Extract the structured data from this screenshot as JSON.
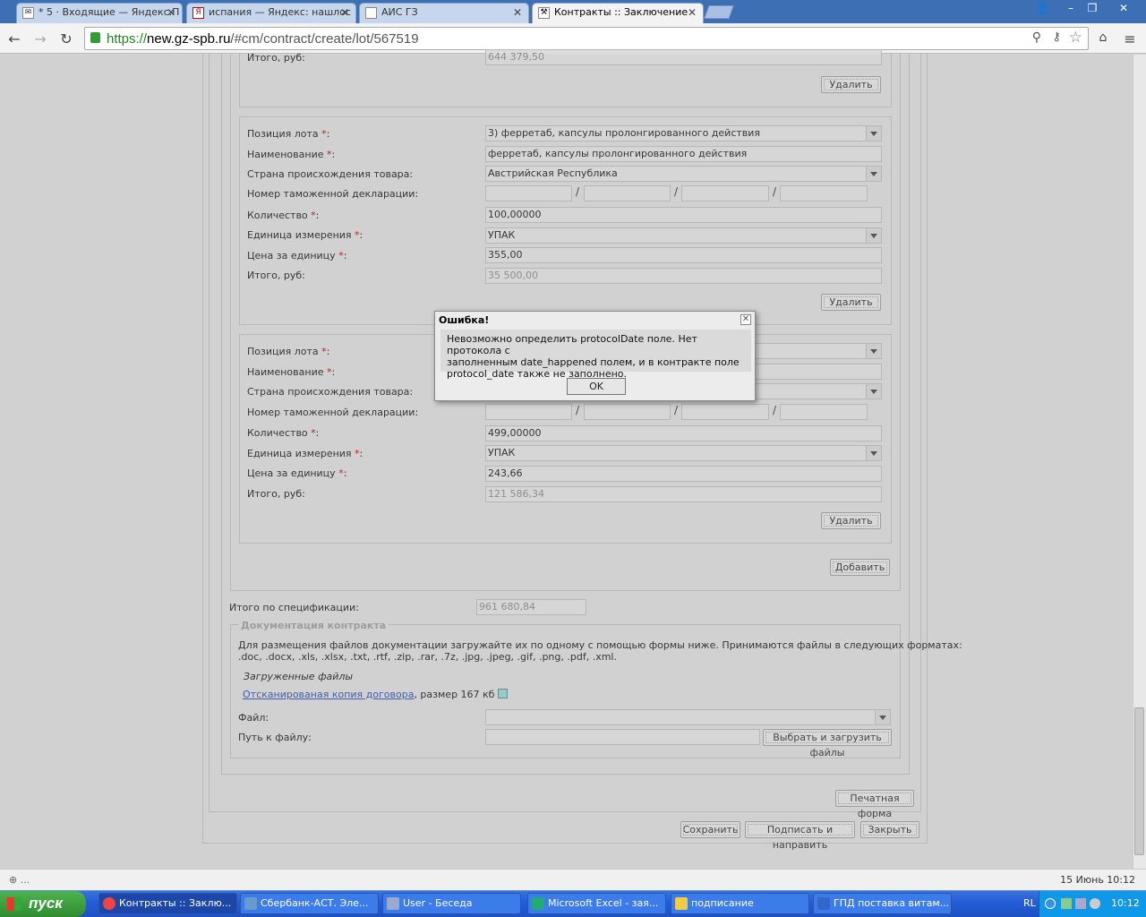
{
  "browser": {
    "tabs": [
      {
        "title": "* 5 · Входящие — Яндекс.П",
        "active": false
      },
      {
        "title": "испания — Яндекс: нашлос",
        "active": false
      },
      {
        "title": "АИС ГЗ",
        "active": false
      },
      {
        "title": "Контракты :: Заключение",
        "active": true
      }
    ],
    "url_scheme": "https://",
    "url_host": "new.gz-spb.ru",
    "url_path": "/#cm/contract/create/lot/567519"
  },
  "lot_top": {
    "total_label": "Итого, руб:",
    "total_value": "644 379,50",
    "delete_label": "Удалить"
  },
  "lot3": {
    "position_label": "Позиция лота",
    "position_value": "3) ферретаб, капсулы пролонгированного действия",
    "name_label": "Наименование",
    "name_value": "ферретаб, капсулы пролонгированного действия",
    "country_label": "Страна происхождения товара:",
    "country_value": "Австрийская Республика",
    "customs_label": "Номер таможенной декларации:",
    "qty_label": "Количество",
    "qty_value": "100,00000",
    "unit_label": "Единица измерения",
    "unit_value": "УПАК",
    "price_label": "Цена за единицу",
    "price_value": "355,00",
    "total_label": "Итого, руб:",
    "total_value": "35 500,00",
    "delete_label": "Удалить"
  },
  "lot4": {
    "position_label": "Позиция лота",
    "name_label": "Наименование",
    "country_label": "Страна происхождения товара:",
    "customs_label": "Номер таможенной декларации:",
    "qty_label": "Количество",
    "qty_value": "499,00000",
    "unit_label": "Единица измерения",
    "unit_value": "УПАК",
    "price_label": "Цена за единицу",
    "price_value": "243,66",
    "total_label": "Итого, руб:",
    "total_value": "121 586,34",
    "delete_label": "Удалить"
  },
  "req_mark": "*",
  "colon": ":",
  "slash": "/",
  "add_label": "Добавить",
  "spec_total_label": "Итого по спецификации:",
  "spec_total_value": "961 680,84",
  "docs": {
    "legend": "Документация контракта",
    "info_line1": "Для размещения файлов документации загружайте их по одному с помощью формы ниже. Принимаются файлы в следующих форматах:",
    "info_line2": ".doc, .docx, .xls, .xlsx, .txt, .rtf, .zip, .rar, .7z, .jpg, .jpeg, .gif, .png, .pdf, .xml.",
    "uploaded_label": "Загруженные файлы",
    "file_link": "Отсканированая копия договора",
    "file_size": ", размер 167 кб",
    "file_label": "Файл:",
    "path_label": "Путь к файлу:",
    "upload_button": "Выбрать и загрузить файлы"
  },
  "print_button": "Печатная форма",
  "footer_buttons": {
    "save": "Сохранить",
    "sign": "Подписать и направить",
    "close": "Закрыть"
  },
  "modal": {
    "title": "Ошибка!",
    "line1": "Невозможно определить protocolDate поле. Нет протокола с",
    "line2": "заполненным date_happened полем, и в контракте поле",
    "line3": "protocol_date также не заполнено.",
    "ok": "OK"
  },
  "statusbar": {
    "left": "...",
    "right": "15 Июнь 10:12"
  },
  "taskbar": {
    "start": "пуск",
    "tasks": [
      {
        "label": "Контракты :: Заклю...",
        "active": true
      },
      {
        "label": "Сбербанк-АСТ. Эле...",
        "active": false
      },
      {
        "label": "User - Беседа",
        "active": false
      },
      {
        "label": "Microsoft Excel - зая...",
        "active": false
      },
      {
        "label": "подписание",
        "active": false
      },
      {
        "label": "ГПД поставка витам...",
        "active": false
      }
    ],
    "lang": "RL",
    "clock": "10:12"
  },
  "colors": {
    "tabbar": "#3d6fb5",
    "page_bg": "#d6d6d6",
    "required": "#cc0000",
    "link": "#2a4fb0",
    "taskbar": "#245ed8"
  }
}
